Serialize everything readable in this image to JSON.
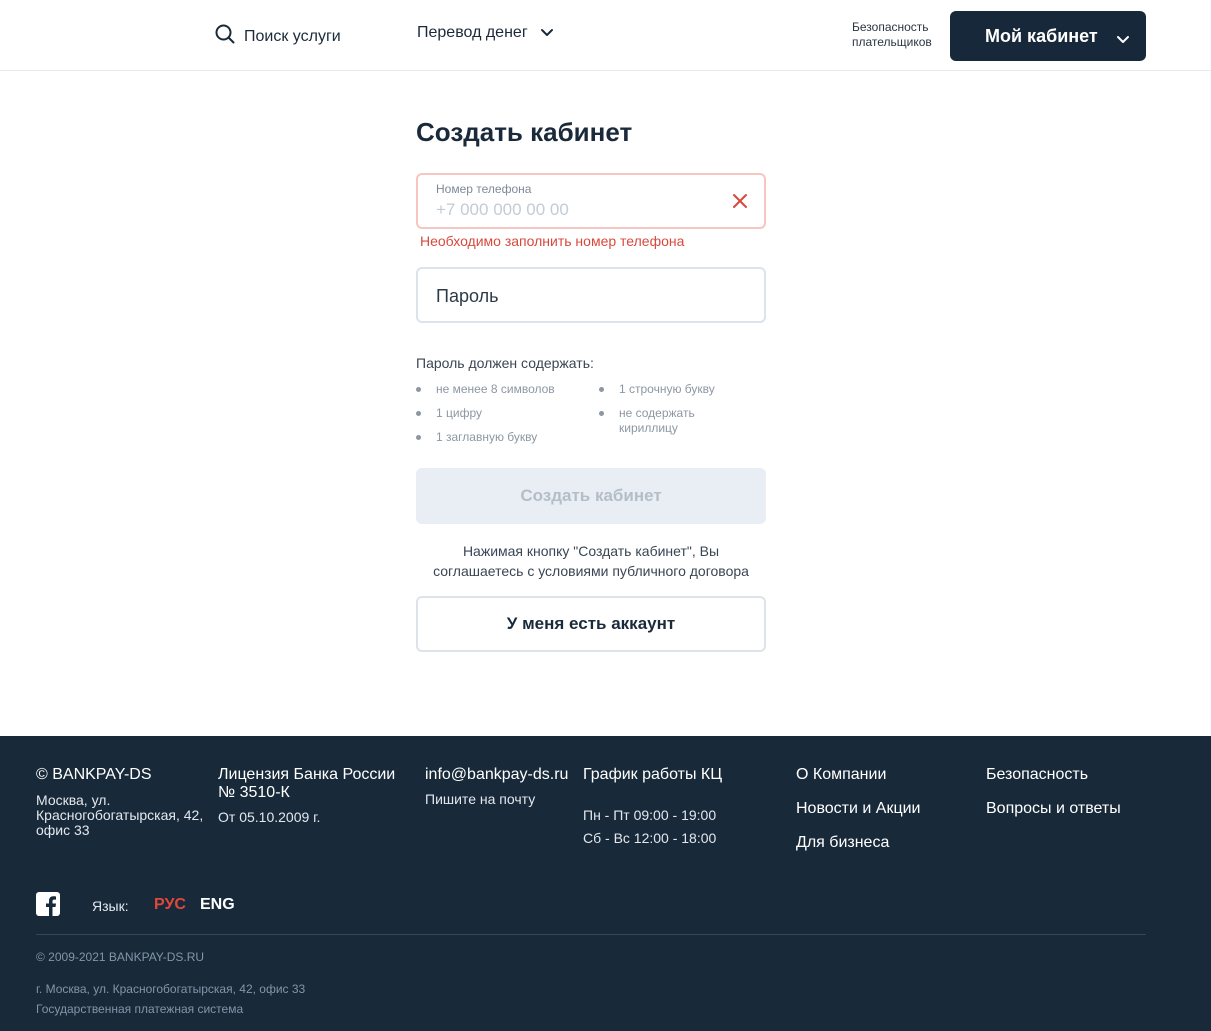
{
  "header": {
    "search_label": "Поиск услуги",
    "transfer_label": "Перевод денег",
    "safety_line1": "Безопасность",
    "safety_line2": "плательщиков",
    "cabinet_label": "Мой кабинет"
  },
  "form": {
    "title": "Создать кабинет",
    "phone_label": "Номер телефона",
    "phone_placeholder": "+7 000 000 00 00",
    "phone_value": "",
    "phone_error": "Необходимо заполнить номер телефона",
    "password_placeholder": "Пароль",
    "password_value": "",
    "requirements_title": "Пароль должен содержать:",
    "requirements": [
      "не менее 8 символов",
      "1 цифру",
      "1 заглавную букву",
      "1 строчную букву",
      "не содержать кириллицу"
    ],
    "create_label": "Создать кабинет",
    "terms_line1": "Нажимая кнопку \"Создать кабинет\", Вы",
    "terms_line2": "соглашаетесь с условиями публичного договора",
    "account_label": "У меня есть аккаунт"
  },
  "footer": {
    "brand": "© BANKPAY-DS",
    "address_line1": "Москва, ул.",
    "address_line2": "Красногобогатырская, 42,",
    "address_line3": "офис 33",
    "license_line1": "Лицензия Банка России",
    "license_line2": "№ 3510-К",
    "license_date": "От 05.10.2009 г.",
    "email": "info@bankpay-ds.ru",
    "email_hint": "Пишите на почту",
    "schedule_title": "График работы КЦ",
    "schedule_weekdays": "Пн - Пт 09:00 - 19:00",
    "schedule_weekend": "Сб - Вс 12:00 - 18:00",
    "links_col1": [
      "О Компании",
      "Новости и Акции",
      "Для бизнеса"
    ],
    "links_col2": [
      "Безопасность",
      "Вопросы и ответы"
    ],
    "language_label": "Язык:",
    "lang_ru": "РУС",
    "lang_en": "ENG",
    "copyright": "© 2009-2021 BANKPAY-DS.RU",
    "bottom_address": "г. Москва, ул. Красногобогатырская, 42, офис 33",
    "bottom_system": "Государственная платежная система"
  },
  "colors": {
    "accent_dark": "#17283a",
    "error": "#d9483c",
    "lang_active": "#e0483c"
  },
  "icons": [
    "search-icon",
    "chevron-down-icon",
    "close-icon",
    "facebook-icon"
  ]
}
